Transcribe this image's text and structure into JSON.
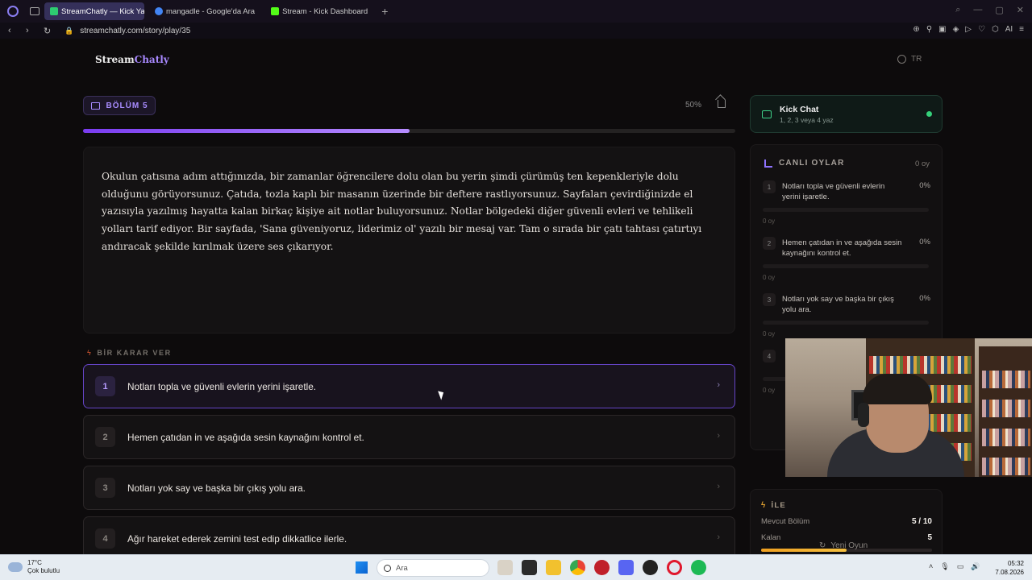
{
  "browser": {
    "tabs": [
      {
        "label": "StreamChatly — Kick Yayın",
        "active": true,
        "favicon_color": "#2ecc71"
      },
      {
        "label": "mangadle - Google'da Ara",
        "active": false,
        "favicon_color": "#4285f4"
      },
      {
        "label": "Stream - Kick Dashboard",
        "active": false,
        "favicon_color": "#53fc18"
      }
    ],
    "new_tab_label": "+",
    "url": "streamchatly.com/story/play/35",
    "ai_label": "AI"
  },
  "brand": {
    "part1": "Stream",
    "part2": "Chatly"
  },
  "lang": "TR",
  "chapter": {
    "label": "BÖLÜM 5",
    "percent_label": "50%",
    "progress": 0.5
  },
  "story_text": "Okulun çatısına adım attığınızda, bir zamanlar öğrencilere dolu olan bu yerin şimdi çürümüş ten kepenkleriyle dolu olduğunu görüyorsunuz. Çatıda, tozla kaplı bir masanın üzerinde bir deftere rastlıyorsunuz. Sayfaları çevirdiğinizde el yazısıyla yazılmış hayatta kalan birkaç kişiye ait notlar buluyorsunuz. Notlar bölgedeki diğer güvenli evleri ve tehlikeli yolları tarif ediyor. Bir sayfada, 'Sana güveniyoruz, liderimiz ol' yazılı bir mesaj var. Tam o sırada bir çatı tahtası çatırtıyı andıracak şekilde kırılmak üzere ses çıkarıyor.",
  "decision_label": "BİR KARAR VER",
  "choices": [
    {
      "num": "1",
      "text": "Notları topla ve güvenli evlerin yerini işaretle."
    },
    {
      "num": "2",
      "text": "Hemen çatıdan in ve aşağıda sesin kaynağını kontrol et."
    },
    {
      "num": "3",
      "text": "Notları yok say ve başka bir çıkış yolu ara."
    },
    {
      "num": "4",
      "text": "Ağır hareket ederek zemini test edip dikkatlice ilerle."
    }
  ],
  "kick_chat": {
    "title": "Kick Chat",
    "subtitle": "1, 2, 3 veya 4 yaz",
    "status_color": "#35d07a"
  },
  "live_votes": {
    "title": "CANLI OYLAR",
    "total": "0 oy",
    "items": [
      {
        "num": "1",
        "text": "Notları topla ve güvenli evlerin yerini işaretle.",
        "pct": "0%",
        "count": "0 oy"
      },
      {
        "num": "2",
        "text": "Hemen çatıdan in ve aşağıda sesin kaynağını kontrol et.",
        "pct": "0%",
        "count": "0 oy"
      },
      {
        "num": "3",
        "text": "Notları yok say ve başka bir çıkış yolu ara.",
        "pct": "0%",
        "count": "0 oy"
      },
      {
        "num": "4",
        "text": "",
        "pct": "",
        "count": "0 oy"
      }
    ]
  },
  "progress_info": {
    "title": "İLE",
    "current_label": "Mevcut Bölüm",
    "current_value": "5 / 10",
    "remaining_label": "Kalan",
    "remaining_value": "5",
    "fraction": 0.5
  },
  "new_game": "Yeni Oyun",
  "taskbar": {
    "temperature": "17°C",
    "weather": "Çok bulutlu",
    "search_placeholder": "Ara",
    "time": "05:32",
    "date": "7.08.2026"
  }
}
